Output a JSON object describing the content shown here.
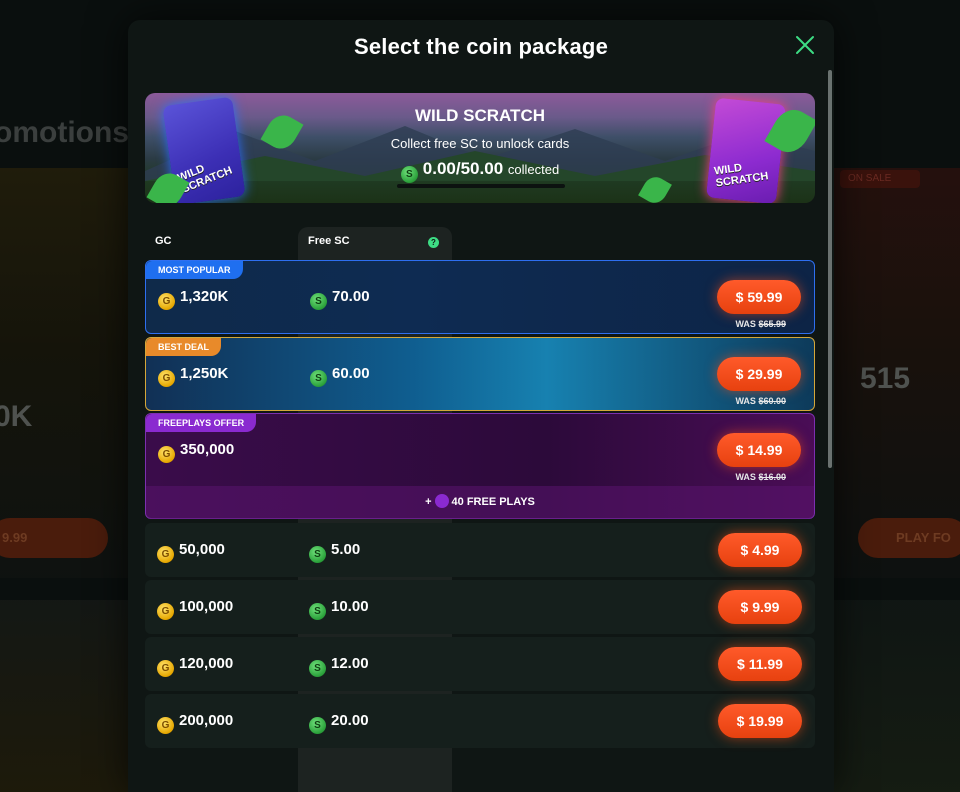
{
  "background": {
    "title": "omotions",
    "left_amount": "0K",
    "left_button": "9.99",
    "right_amount": "515",
    "right_button": "PLAY FO",
    "right_tag": "ON SALE"
  },
  "modal": {
    "title": "Select the coin package",
    "close_icon": "close-icon"
  },
  "banner": {
    "title": "WILD SCRATCH",
    "subtitle": "Collect free SC to unlock cards",
    "progress": "0.00/50.00",
    "progress_suffix": "collected",
    "progress_fraction": 0.0,
    "card_label": "WILD SCRATCH"
  },
  "table": {
    "gc_header": "GC",
    "sc_header": "Free SC",
    "coin_gc": "G",
    "coin_sc": "S"
  },
  "featured": [
    {
      "tag": "MOST POPULAR",
      "gc": "1,320K",
      "sc": "70.00",
      "price": "$ 59.99",
      "was_label": "WAS",
      "was_price": "$65.99"
    },
    {
      "tag": "BEST DEAL",
      "gc": "1,250K",
      "sc": "60.00",
      "price": "$ 29.99",
      "was_label": "WAS",
      "was_price": "$60.00"
    },
    {
      "tag": "FREEPLAYS OFFER",
      "gc": "350,000",
      "price": "$ 14.99",
      "was_label": "WAS",
      "was_price": "$16.00",
      "free_plays_prefix": "+",
      "free_plays": "40 FREE PLAYS"
    }
  ],
  "packages": [
    {
      "gc": "50,000",
      "sc": "5.00",
      "price": "$ 4.99"
    },
    {
      "gc": "100,000",
      "sc": "10.00",
      "price": "$ 9.99"
    },
    {
      "gc": "120,000",
      "sc": "12.00",
      "price": "$ 11.99"
    },
    {
      "gc": "200,000",
      "sc": "20.00",
      "price": "$ 19.99"
    }
  ],
  "colors": {
    "accent_orange": "#ff5a2a",
    "popular_border": "#2e6ff0",
    "best_border": "#d4a73a",
    "freeplays_border": "#7d2fb0"
  }
}
